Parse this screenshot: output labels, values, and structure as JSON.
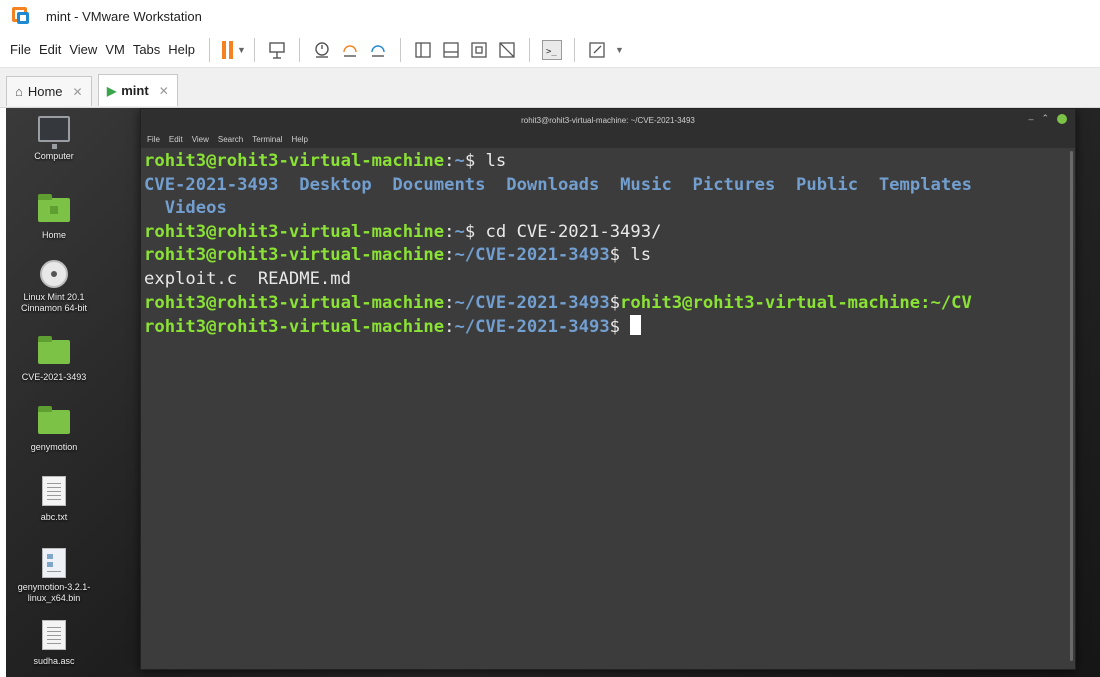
{
  "window": {
    "title": "mint - VMware Workstation"
  },
  "menu": [
    "File",
    "Edit",
    "View",
    "VM",
    "Tabs",
    "Help"
  ],
  "toolbar_icons": [
    "pause-icon",
    "send-ctrl-alt-del-icon",
    "snapshot-icon",
    "revert-snapshot-icon",
    "manage-snapshots-icon",
    "console-view-icon",
    "thumbnail-bar-icon",
    "fullscreen-icon",
    "unity-icon",
    "terminal-console-icon",
    "stretch-icon"
  ],
  "tabs": [
    {
      "label": "Home",
      "icon": "home-icon",
      "active": false
    },
    {
      "label": "mint",
      "icon": "vm-running-icon",
      "active": true
    }
  ],
  "desktop_icons": [
    {
      "label": "Computer",
      "icon": "computer-icon"
    },
    {
      "label": "Home",
      "icon": "home-folder-icon"
    },
    {
      "label": "Linux Mint 20.1 Cinnamon 64-bit",
      "icon": "disc-icon"
    },
    {
      "label": "CVE-2021-3493",
      "icon": "folder-icon"
    },
    {
      "label": "genymotion",
      "icon": "folder-icon"
    },
    {
      "label": "abc.txt",
      "icon": "text-file-icon"
    },
    {
      "label": "genymotion-3.2.1-linux_x64.bin",
      "icon": "binary-file-icon"
    },
    {
      "label": "sudha.asc",
      "icon": "text-file-icon"
    }
  ],
  "terminal": {
    "title": "rohit3@rohit3-virtual-machine: ~/CVE-2021-3493",
    "menu": [
      "File",
      "Edit",
      "View",
      "Search",
      "Terminal",
      "Help"
    ],
    "user_host": "rohit3@rohit3-virtual-machine",
    "lines": [
      {
        "path": "~",
        "command": " ls"
      },
      {
        "path": "~",
        "command": " cd CVE-2021-3493/"
      },
      {
        "path": "~/CVE-2021-3493",
        "command": " ls"
      }
    ],
    "ls_home_row1": [
      "CVE-2021-3493",
      "Desktop",
      "Documents",
      "Downloads",
      "Music",
      "Pictures",
      "Public",
      "Templates"
    ],
    "ls_home_row2": "Videos",
    "ls_cve": "exploit.c  README.md",
    "wrapped_prompt_tail": "rohit3@rohit3-virtual-machine:~/CV",
    "final_path": "~/CVE-2021-3493"
  },
  "colors": {
    "prompt_user": "#8ae234",
    "prompt_path": "#729fcf",
    "terminal_bg": "#3c3c3c",
    "vmware_accent": "#f58220"
  }
}
